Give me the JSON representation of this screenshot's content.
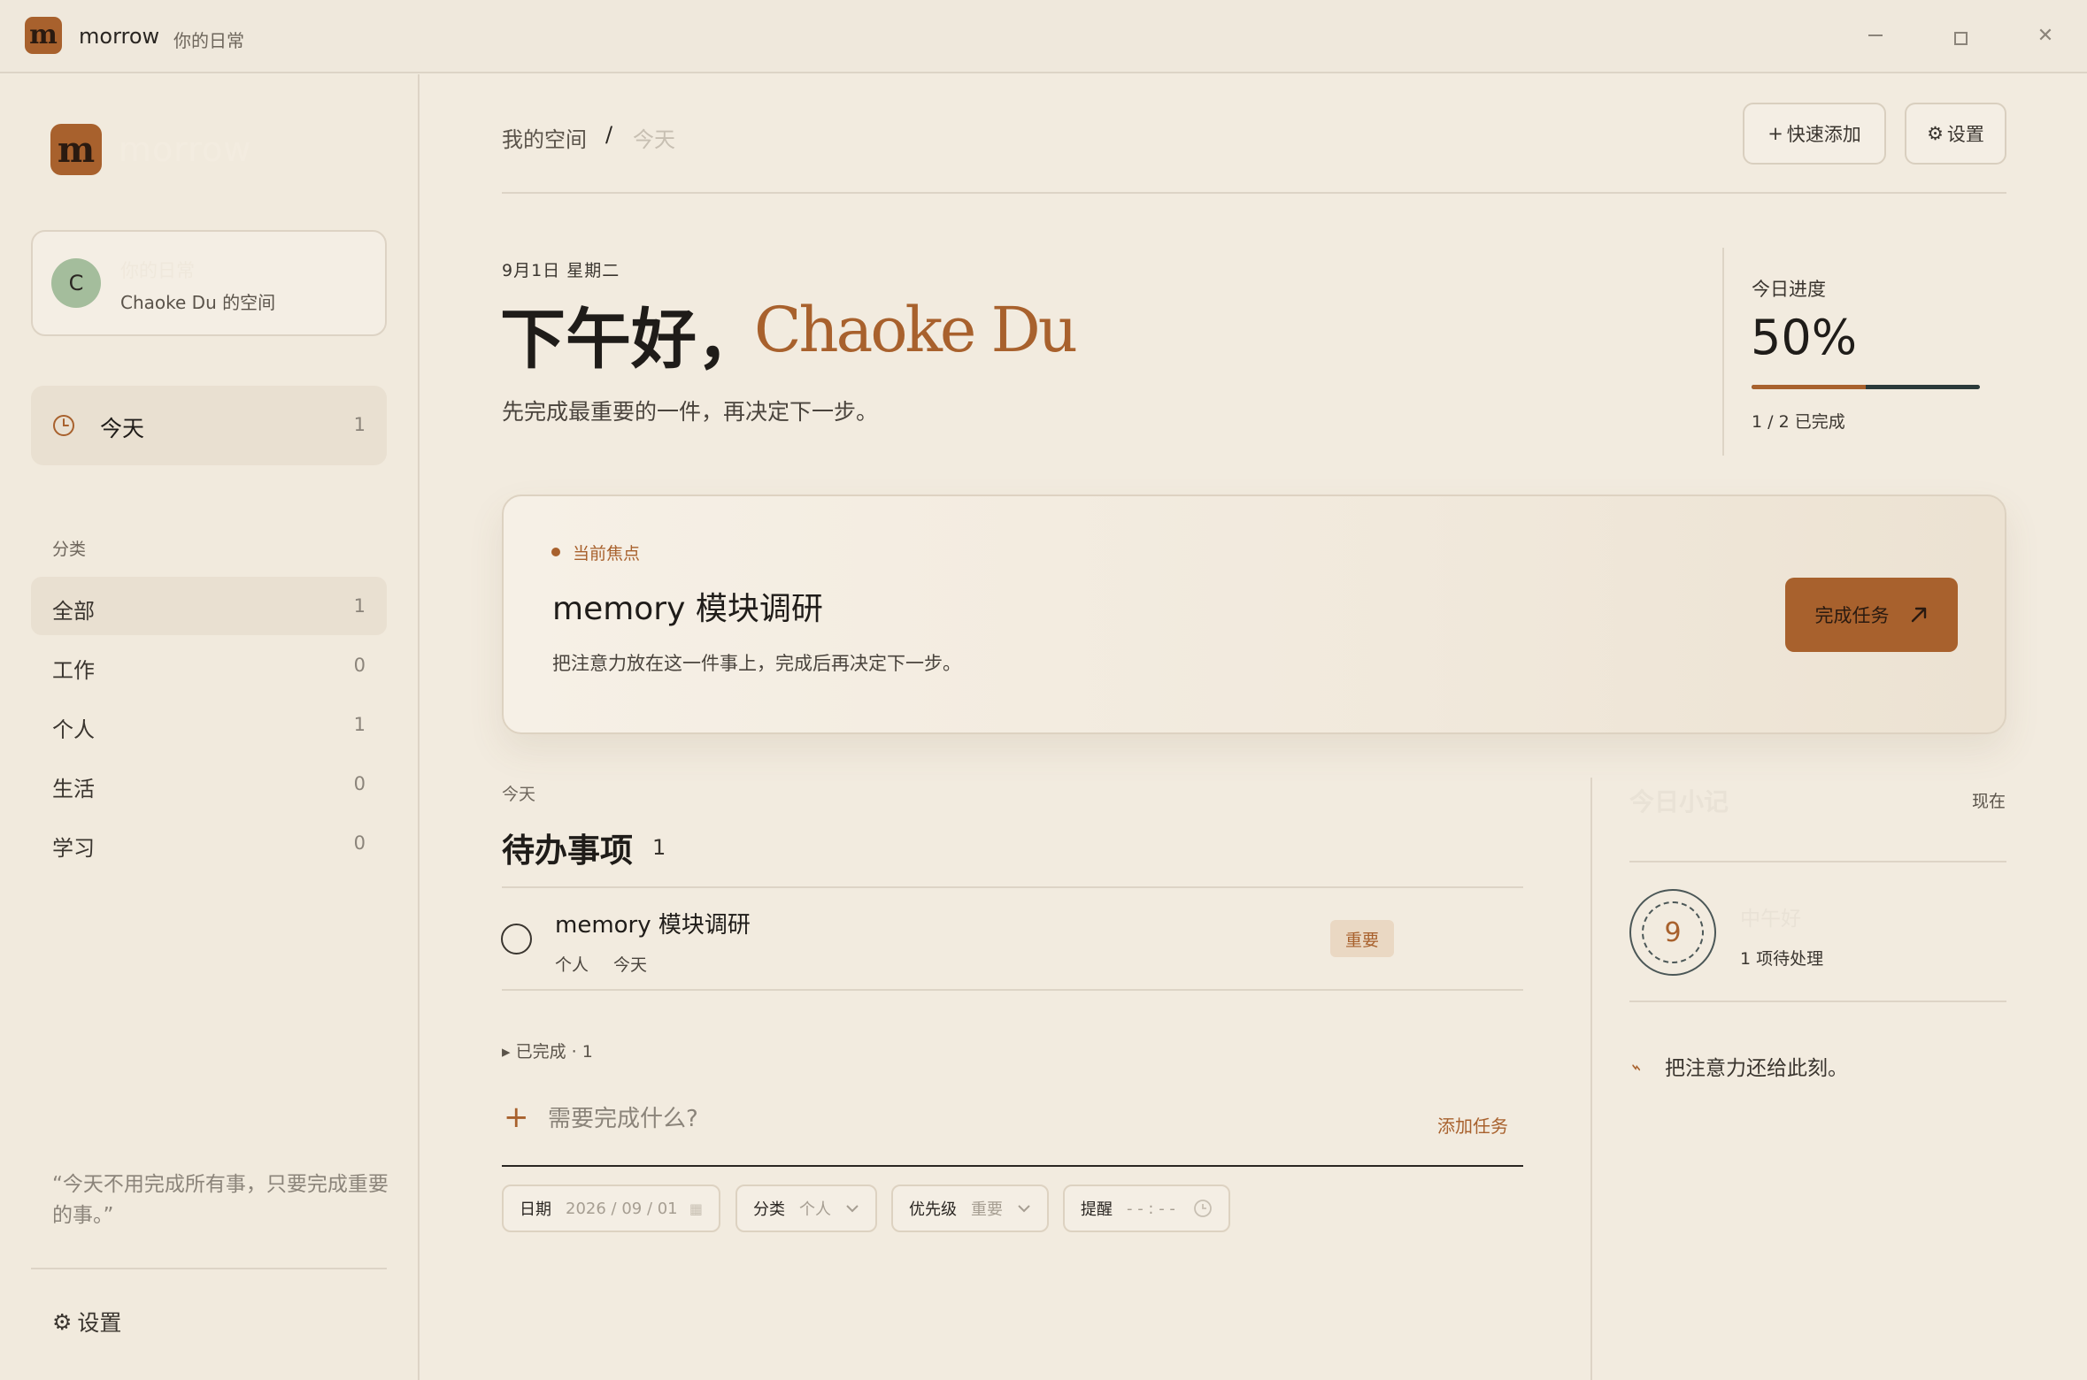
{
  "titlebar": {
    "logo_letter": "m",
    "app_name": "morrow",
    "subtitle": "你的日常"
  },
  "sidebar": {
    "logo_letter": "m",
    "brand": "morrow",
    "profile": {
      "avatar_letter": "C",
      "title": "你的日常",
      "subtitle": "Chaoke Du 的空间"
    },
    "today": {
      "label": "今天",
      "count": "1"
    },
    "categories_heading": "分类",
    "categories": [
      {
        "label": "全部",
        "count": "1",
        "active": true
      },
      {
        "label": "工作",
        "count": "0",
        "active": false
      },
      {
        "label": "个人",
        "count": "1",
        "active": false
      },
      {
        "label": "生活",
        "count": "0",
        "active": false
      },
      {
        "label": "学习",
        "count": "0",
        "active": false
      }
    ],
    "quote": "“今天不用完成所有事，只要完成重要的事。”",
    "settings_label": "设置"
  },
  "header": {
    "breadcrumb_home": "我的空间",
    "breadcrumb_sep": "/",
    "breadcrumb_current": "今天",
    "quick_add_label": "快速添加",
    "settings_label": "设置"
  },
  "hero": {
    "date": "9月1日 星期二",
    "greeting": "下午好，",
    "name": "Chaoke Du",
    "subtitle": "先完成最重要的一件，再决定下一步。"
  },
  "progress": {
    "label": "今日进度",
    "value": "50%",
    "fraction": 0.5,
    "count_text": "1 / 2 已完成"
  },
  "focus": {
    "tag": "当前焦点",
    "title": "memory 模块调研",
    "description": "把注意力放在这一件事上，完成后再决定下一步。",
    "button_label": "完成任务"
  },
  "todos": {
    "eyebrow": "今天",
    "title": "待办事项",
    "count": "1",
    "items": [
      {
        "name": "memory 模块调研",
        "category": "个人",
        "due": "今天",
        "priority": "重要"
      }
    ],
    "completed_toggle": "已完成 · 1"
  },
  "add_task": {
    "placeholder": "需要完成什么?",
    "submit_label": "添加任务",
    "date_key": "日期",
    "date_value": "2026 / 09 / 01",
    "category_key": "分类",
    "category_value": "个人",
    "priority_key": "优先级",
    "priority_value": "重要",
    "reminder_key": "提醒",
    "reminder_value": "- - : - -"
  },
  "notes": {
    "title": "今日小记",
    "time": "现在",
    "ring_number": "9",
    "greeting": "中午好",
    "pending": "1 项待处理",
    "message": "把注意力还给此刻。"
  },
  "colors": {
    "accent": "#a8612d",
    "background": "#f2ebdf",
    "sidebar": "#f1eadd",
    "active_item": "#e9e0d1",
    "avatar": "#a4bd9c",
    "progress_track": "#2b3a3a"
  }
}
